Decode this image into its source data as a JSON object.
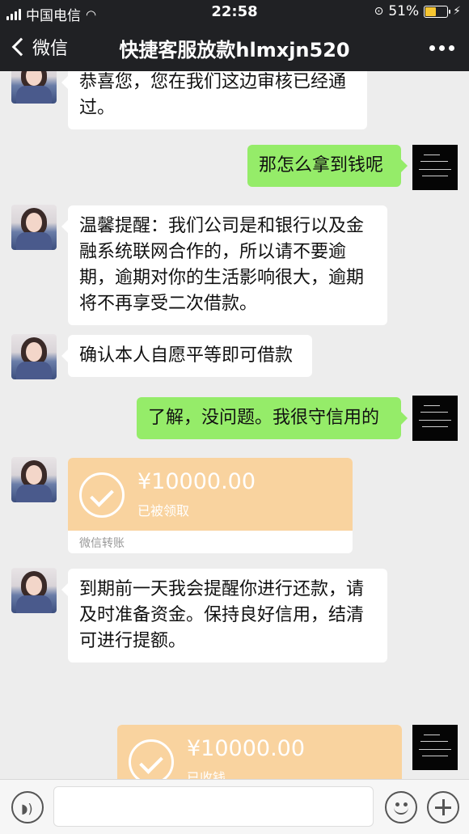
{
  "status_bar": {
    "carrier": "中国电信",
    "time": "22:58",
    "battery": "51%",
    "battery_level": 0.51
  },
  "nav": {
    "back_label": "微信",
    "title": "快捷客服放款hlmxjn520"
  },
  "messages": [
    {
      "side": "left",
      "type": "text",
      "text": "恭喜您，您在我们这边审核已经通过。"
    },
    {
      "side": "right",
      "type": "text",
      "text": "那怎么拿到钱呢"
    },
    {
      "side": "left",
      "type": "text",
      "text": "温馨提醒：我们公司是和银行以及金融系统联网合作的，所以请不要逾期，逾期对你的生活影响很大，逾期将不再享受二次借款。"
    },
    {
      "side": "left",
      "type": "text",
      "text": "确认本人自愿平等即可借款"
    },
    {
      "side": "right",
      "type": "text",
      "text": "了解，没问题。我很守信用的"
    },
    {
      "side": "left",
      "type": "transfer",
      "amount": "¥10000.00",
      "status": "已被领取",
      "footer": "微信转账"
    },
    {
      "side": "left",
      "type": "text",
      "text": "到期前一天我会提醒你进行还款，请及时准备资金。保持良好信用，结清可进行提额。"
    },
    {
      "side": "right",
      "type": "transfer",
      "amount": "¥10000.00",
      "status": "已收钱"
    }
  ],
  "colors": {
    "header_bg": "#202124",
    "chat_bg": "#ededed",
    "self_bubble": "#95ec69",
    "transfer_bg": "#f9d39f"
  },
  "icons": [
    "back-chevron-icon",
    "more-icon",
    "voice-icon",
    "emoji-icon",
    "plus-icon",
    "check-icon"
  ]
}
